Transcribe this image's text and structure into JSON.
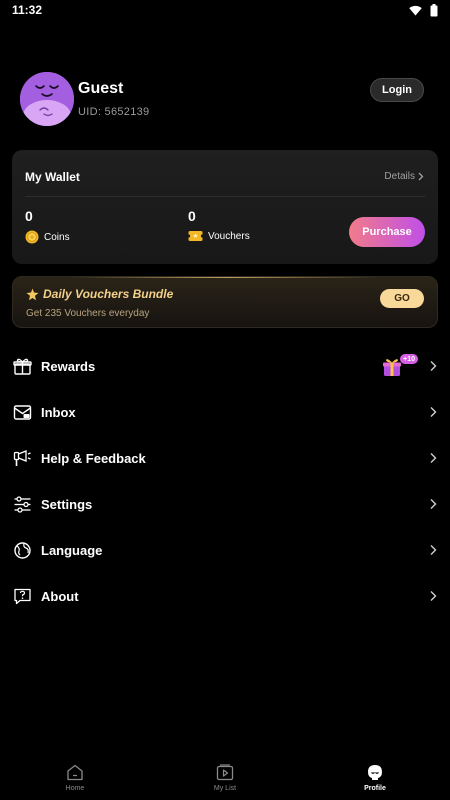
{
  "status_bar": {
    "time": "11:32"
  },
  "profile": {
    "name": "Guest",
    "uid": "UID: 5652139",
    "login_label": "Login"
  },
  "wallet": {
    "title": "My Wallet",
    "details_label": "Details",
    "coins": {
      "value": "0",
      "label": "Coins"
    },
    "vouchers": {
      "value": "0",
      "label": "Vouchers"
    },
    "purchase_label": "Purchase"
  },
  "bundle": {
    "title": "Daily Vouchers Bundle",
    "subtitle": "Get 235 Vouchers everyday",
    "go_label": "GO"
  },
  "menu": {
    "items": [
      {
        "label": "Rewards",
        "icon": "gift-icon",
        "badge": "+10"
      },
      {
        "label": "Inbox",
        "icon": "inbox-icon"
      },
      {
        "label": "Help & Feedback",
        "icon": "help-feedback-icon"
      },
      {
        "label": "Settings",
        "icon": "settings-sliders-icon"
      },
      {
        "label": "Language",
        "icon": "globe-icon"
      },
      {
        "label": "About",
        "icon": "about-icon"
      }
    ]
  },
  "bottom_nav": {
    "items": [
      {
        "label": "Home",
        "icon": "home-icon"
      },
      {
        "label": "My List",
        "icon": "play-list-icon"
      },
      {
        "label": "Profile",
        "icon": "profile-icon"
      }
    ],
    "active": "Profile"
  },
  "colors": {
    "background": "#000000",
    "card": "#1c1c1c",
    "purchase_gradient_start": "#f27b8a",
    "purchase_gradient_end": "#c04fe8",
    "bundle_accent": "#f3d08a",
    "avatar": "#a45ee0"
  }
}
